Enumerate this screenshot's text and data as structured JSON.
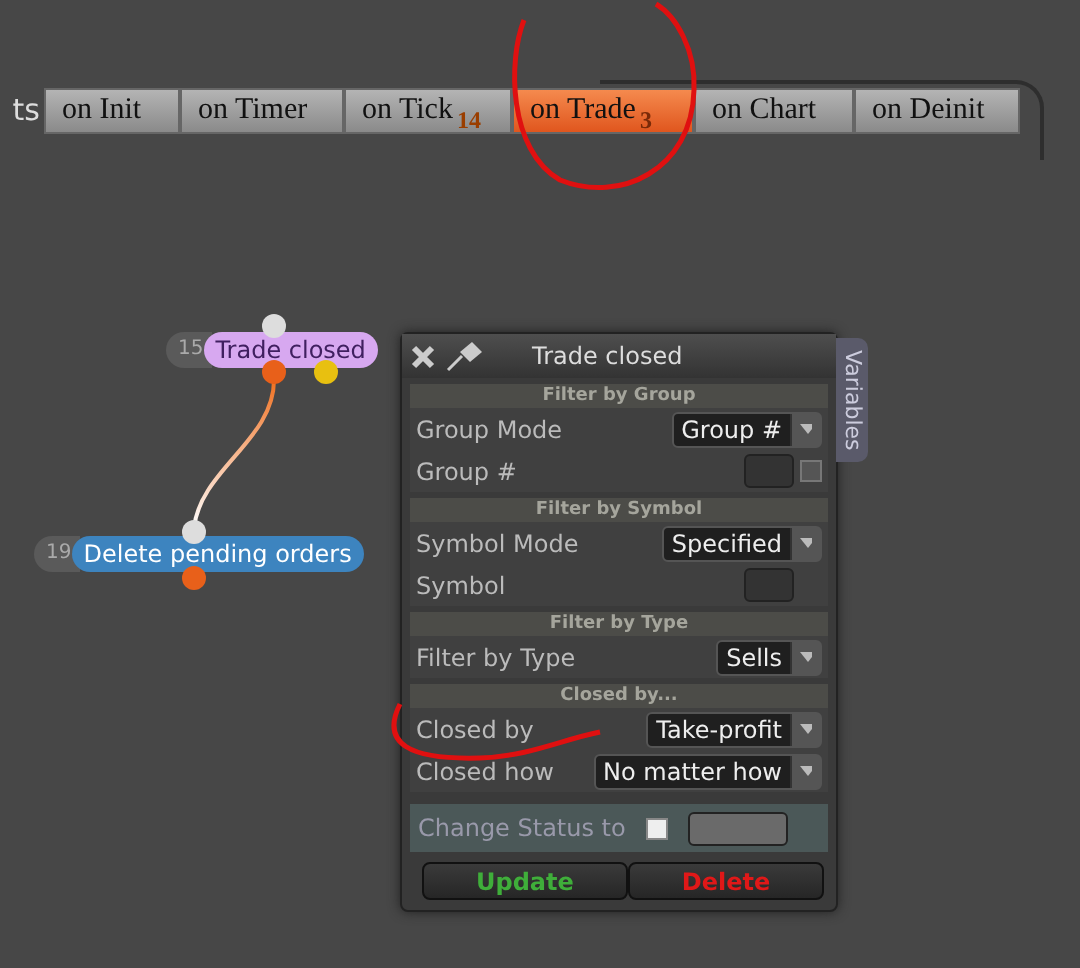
{
  "tab_bar": {
    "cut_label": "ts",
    "tabs": [
      {
        "label": "on Init",
        "selected": false
      },
      {
        "label": "on Timer",
        "selected": false
      },
      {
        "label": "on Tick",
        "count": "14",
        "selected": false
      },
      {
        "label": "on Trade",
        "count": "3",
        "selected": true
      },
      {
        "label": "on Chart",
        "selected": false
      },
      {
        "label": "on Deinit",
        "selected": false
      }
    ]
  },
  "nodes": [
    {
      "number": "15",
      "label": "Trade closed",
      "color": "#d7a8f0"
    },
    {
      "number": "19",
      "label": "Delete pending orders",
      "color": "#3d84bf"
    }
  ],
  "dialog": {
    "title": "Trade closed",
    "side_tab": "Variables",
    "sections": [
      {
        "heading": "Filter by Group",
        "rows": [
          {
            "label": "Group Mode",
            "kind": "select",
            "value": "Group #"
          },
          {
            "label": "Group #",
            "kind": "field",
            "checked": false
          }
        ]
      },
      {
        "heading": "Filter by Symbol",
        "rows": [
          {
            "label": "Symbol Mode",
            "kind": "select",
            "value": "Specified"
          },
          {
            "label": "Symbol",
            "kind": "field"
          }
        ]
      },
      {
        "heading": "Filter by Type",
        "rows": [
          {
            "label": "Filter by Type",
            "kind": "select",
            "value": "Sells"
          }
        ]
      },
      {
        "heading": "Closed by...",
        "rows": [
          {
            "label": "Closed by",
            "kind": "select",
            "value": "Take-profit"
          },
          {
            "label": "Closed how",
            "kind": "select",
            "value": "No matter how"
          }
        ]
      }
    ],
    "status_row": {
      "label": "Change Status to",
      "checked": false
    },
    "buttons": [
      {
        "label": "Update",
        "kind": "confirm"
      },
      {
        "label": "Delete",
        "kind": "danger"
      }
    ]
  }
}
